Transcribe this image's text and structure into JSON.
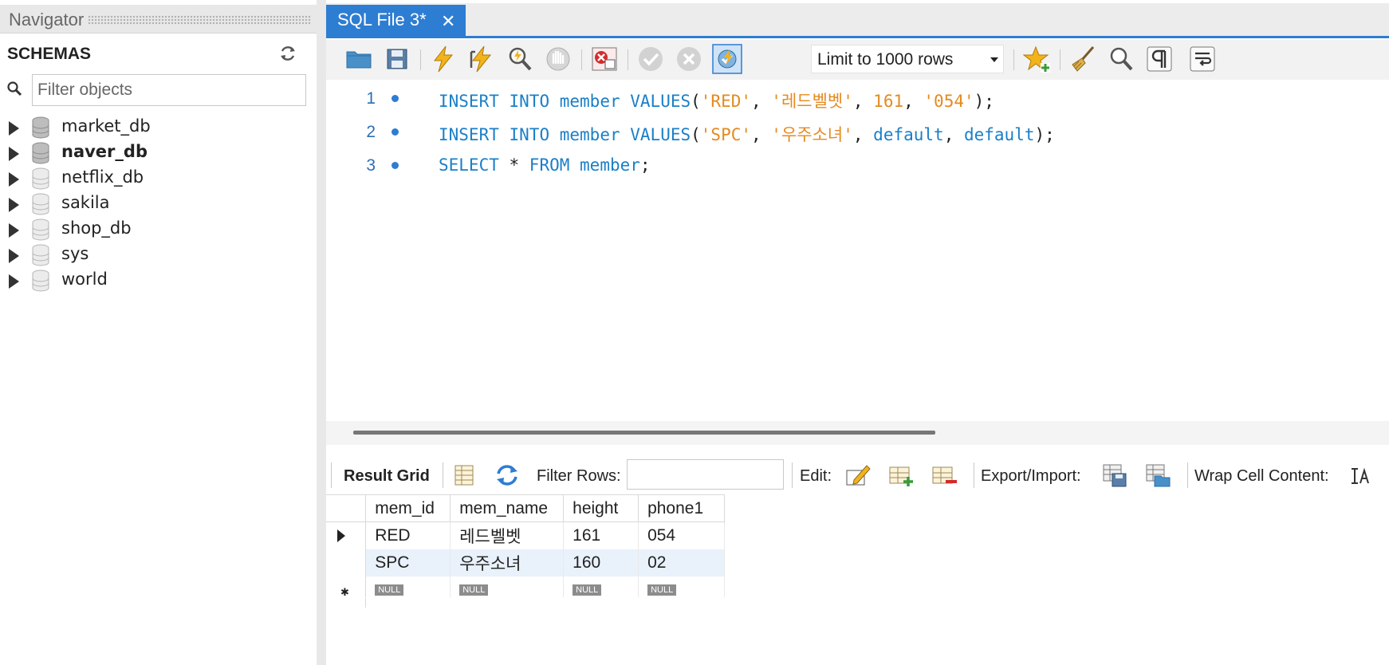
{
  "navigator": {
    "title": "Navigator",
    "schemas_label": "SCHEMAS",
    "filter_placeholder": "Filter objects",
    "schemas": [
      {
        "name": "market_db",
        "bold": false
      },
      {
        "name": "naver_db",
        "bold": true
      },
      {
        "name": "netflix_db",
        "bold": false
      },
      {
        "name": "sakila",
        "bold": false
      },
      {
        "name": "shop_db",
        "bold": false
      },
      {
        "name": "sys",
        "bold": false
      },
      {
        "name": "world",
        "bold": false
      }
    ]
  },
  "editor": {
    "tab_label": "SQL File 3*",
    "tab_close": "✕",
    "limit_label": "Limit to 1000 rows",
    "lines": [
      {
        "number": "1"
      },
      {
        "number": "2"
      },
      {
        "number": "3"
      }
    ],
    "code": {
      "l1": {
        "kw1": "INSERT",
        "kw2": "INTO",
        "kw3": "member",
        "kw4": "VALUES",
        "p1": "(",
        "s1": "'RED'",
        "c1": ", ",
        "s2": "'레드벨벳'",
        "c2": ", ",
        "n1": "161",
        "c3": ", ",
        "s3": "'054'",
        "end": ");"
      },
      "l2": {
        "kw1": "INSERT",
        "kw2": "INTO",
        "kw3": "member",
        "kw4": "VALUES",
        "p1": "(",
        "s1": "'SPC'",
        "c1": ", ",
        "s2": "'우주소녀'",
        "c2": ", ",
        "kw5": "default",
        "c3": ", ",
        "kw6": "default",
        "end": ");"
      },
      "l3": {
        "kw1": "SELECT",
        "star": " * ",
        "kw2": "FROM",
        "kw3": "member",
        "end": ";"
      }
    }
  },
  "result_toolbar": {
    "result_grid": "Result Grid",
    "filter_rows": "Filter Rows:",
    "edit": "Edit:",
    "export_import": "Export/Import:",
    "wrap_cell": "Wrap Cell Content:"
  },
  "grid": {
    "columns": [
      "mem_id",
      "mem_name",
      "height",
      "phone1"
    ],
    "rows": [
      [
        "RED",
        "레드벨벳",
        "161",
        "054"
      ],
      [
        "SPC",
        "우주소녀",
        "160",
        "02"
      ]
    ],
    "null_label": "NULL"
  },
  "colors": {
    "accent": "#2d7dd2",
    "keyword": "#1a7fc8",
    "string": "#e58a1f"
  }
}
